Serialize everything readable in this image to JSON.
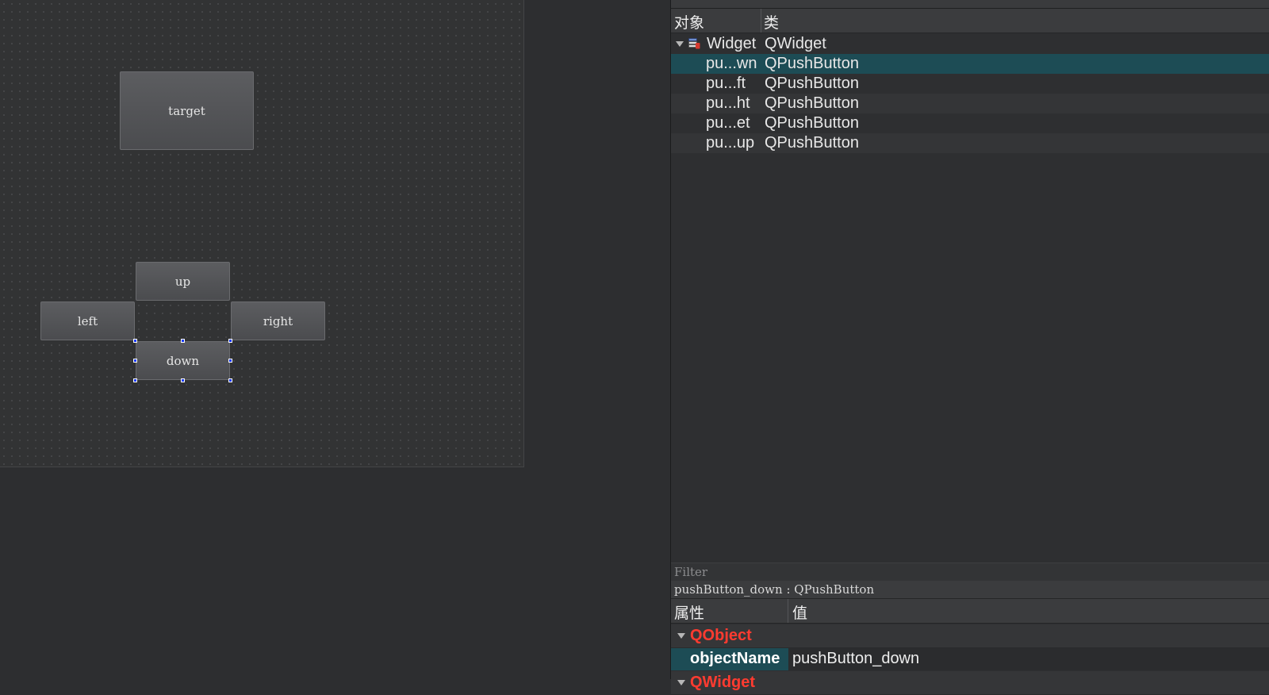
{
  "form": {
    "buttons": {
      "target": "target",
      "up": "up",
      "left": "left",
      "right": "right",
      "down": "down"
    }
  },
  "object_inspector": {
    "headers": {
      "object": "对象",
      "class": "类"
    },
    "root": {
      "name": "Widget",
      "class": "QWidget",
      "icon": "widget-icon"
    },
    "children": [
      {
        "name": "pu...wn",
        "class": "QPushButton",
        "selected": true
      },
      {
        "name": "pu...ft",
        "class": "QPushButton"
      },
      {
        "name": "pu...ht",
        "class": "QPushButton"
      },
      {
        "name": "pu...et",
        "class": "QPushButton"
      },
      {
        "name": "pu...up",
        "class": "QPushButton"
      }
    ]
  },
  "property_editor": {
    "filter_placeholder": "Filter",
    "current_object": "pushButton_down : QPushButton",
    "headers": {
      "property": "属性",
      "value": "值"
    },
    "groups": [
      {
        "name": "QObject"
      },
      {
        "name": "QWidget"
      }
    ],
    "properties": [
      {
        "name": "objectName",
        "value": "pushButton_down"
      }
    ]
  },
  "colors": {
    "selection": "#1d4c55",
    "group_title": "#ff3b30",
    "handle": "#1a3cff"
  }
}
